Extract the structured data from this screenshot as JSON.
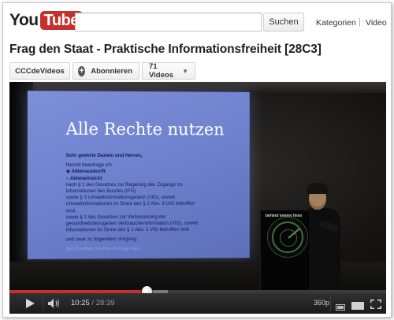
{
  "masthead": {
    "logo_you": "You",
    "logo_tube": "Tube",
    "search_placeholder": "",
    "search_button": "Suchen",
    "nav": {
      "kategorien": "Kategorien",
      "separator": "|",
      "video": "Video"
    }
  },
  "video": {
    "title": "Frag den Staat - Praktische Informationsfreiheit [28C3]"
  },
  "channel": {
    "name": "CCCdeVideos",
    "subscribe": "Abonnieren",
    "videos": "71 Videos"
  },
  "slide": {
    "title": "Alle Rechte nutzen",
    "greeting": "Sehr geehrte Damen und Herren,",
    "line1": "hiermit beantrage ich",
    "option1": "Aktenauskunft",
    "option2": "Akteneinsicht",
    "line2": "nach § 1 des Gesetzes zur Regelung des Zugangs zu",
    "line3": "Informationen des Bundes (IFG)",
    "line4": "sowie § 3 Umweltinformationsgesetz (UIG), soweit",
    "line5": "Umweltinformationen im Sinne des § 2 Abs. 3 UIG betroffen",
    "line6": "sind,",
    "line7": "sowie § 1 des Gesetzes zur Verbesserung der",
    "line8": "gesundheitsbezogenen Verbraucherinformation (VIG), soweit",
    "line9": "Informationen im Sinne des § 1 Abs. 1 VIG betroffen sind",
    "line10": "und zwar zu folgendem Vorgang:",
    "line11": "Beschreiben Sie Ihre Anfrage hier..."
  },
  "podium": {
    "label": "behind enemy lines"
  },
  "player": {
    "current_time": "10:25",
    "separator": " / ",
    "duration": "28:39",
    "quality": "360p",
    "progress_played": 0.364,
    "progress_loaded": 0.42
  },
  "colors": {
    "brand_red": "#c4302b",
    "slide_blue": "#7485d4",
    "player_bg": "#000000"
  },
  "icons": {
    "play": "play-icon",
    "volume": "volume-icon",
    "small_player": "small-player-icon",
    "large_player": "large-player-icon",
    "fullscreen": "fullscreen-icon",
    "subscribe": "plus-icon",
    "dropdown": "caret-down-icon"
  }
}
